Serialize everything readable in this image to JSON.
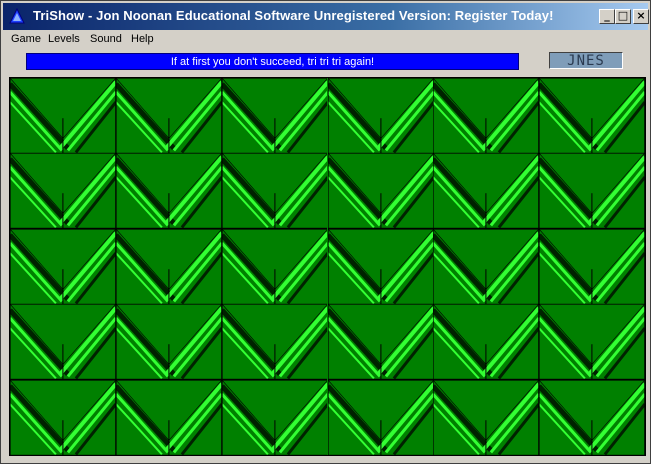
{
  "window": {
    "title": "TriShow - Jon Noonan Educational Software  Unregistered Version: Register Today!",
    "app_icon": "blue-triangle-icon",
    "controls": {
      "minimize": "_",
      "maximize": "□",
      "close": "×"
    }
  },
  "menu": [
    "Game",
    "Levels",
    "Sound",
    "Help"
  ],
  "status_message": "If at first you don't succeed, tri tri tri again!",
  "logo_text": "JNES",
  "board": {
    "rows": 5,
    "cols": 6,
    "tile_pattern": "chevron-triangles",
    "colors": {
      "background": "#008000",
      "bright_stripe": "#33ff33",
      "dark_stripe": "#002200",
      "grid_line": "#000000"
    }
  }
}
